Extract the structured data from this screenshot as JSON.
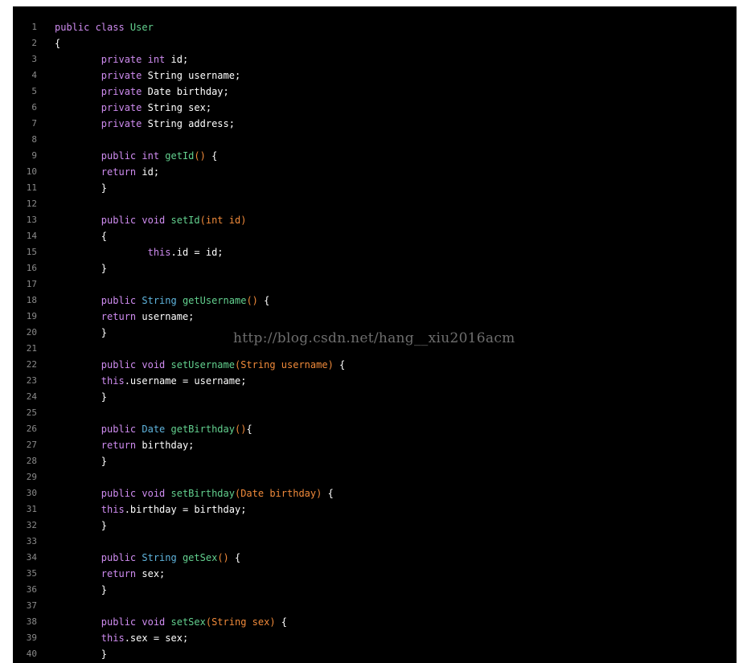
{
  "editor": {
    "lines": [
      {
        "n": "1",
        "tokens": [
          {
            "t": "public class ",
            "c": "kw"
          },
          {
            "t": "User",
            "c": "fn"
          }
        ]
      },
      {
        "n": "2",
        "tokens": [
          {
            "t": "{",
            "c": "pl"
          }
        ]
      },
      {
        "n": "3",
        "tokens": [
          {
            "t": "        ",
            "c": "pl"
          },
          {
            "t": "private int ",
            "c": "kw"
          },
          {
            "t": "id;",
            "c": "pl"
          }
        ]
      },
      {
        "n": "4",
        "tokens": [
          {
            "t": "        ",
            "c": "pl"
          },
          {
            "t": "private ",
            "c": "kw"
          },
          {
            "t": "String username;",
            "c": "pl"
          }
        ]
      },
      {
        "n": "5",
        "tokens": [
          {
            "t": "        ",
            "c": "pl"
          },
          {
            "t": "private ",
            "c": "kw"
          },
          {
            "t": "Date birthday;",
            "c": "pl"
          }
        ]
      },
      {
        "n": "6",
        "tokens": [
          {
            "t": "        ",
            "c": "pl"
          },
          {
            "t": "private ",
            "c": "kw"
          },
          {
            "t": "String sex;",
            "c": "pl"
          }
        ]
      },
      {
        "n": "7",
        "tokens": [
          {
            "t": "        ",
            "c": "pl"
          },
          {
            "t": "private ",
            "c": "kw"
          },
          {
            "t": "String address;",
            "c": "pl"
          }
        ]
      },
      {
        "n": "8",
        "tokens": []
      },
      {
        "n": "9",
        "tokens": [
          {
            "t": "        ",
            "c": "pl"
          },
          {
            "t": "public int ",
            "c": "kw"
          },
          {
            "t": "getId",
            "c": "fn"
          },
          {
            "t": "()",
            "c": "pn"
          },
          {
            "t": " {",
            "c": "pl"
          }
        ]
      },
      {
        "n": "10",
        "tokens": [
          {
            "t": "        ",
            "c": "pl"
          },
          {
            "t": "return ",
            "c": "kw"
          },
          {
            "t": "id;",
            "c": "pl"
          }
        ]
      },
      {
        "n": "11",
        "tokens": [
          {
            "t": "        }",
            "c": "pl"
          }
        ]
      },
      {
        "n": "12",
        "tokens": []
      },
      {
        "n": "13",
        "tokens": [
          {
            "t": "        ",
            "c": "pl"
          },
          {
            "t": "public void ",
            "c": "kw"
          },
          {
            "t": "setId",
            "c": "fn"
          },
          {
            "t": "(int id)",
            "c": "pn"
          }
        ]
      },
      {
        "n": "14",
        "tokens": [
          {
            "t": "        {",
            "c": "pl"
          }
        ]
      },
      {
        "n": "15",
        "tokens": [
          {
            "t": "                ",
            "c": "pl"
          },
          {
            "t": "this",
            "c": "kw"
          },
          {
            "t": ".id = id;",
            "c": "pl"
          }
        ]
      },
      {
        "n": "16",
        "tokens": [
          {
            "t": "        }",
            "c": "pl"
          }
        ]
      },
      {
        "n": "17",
        "tokens": []
      },
      {
        "n": "18",
        "tokens": [
          {
            "t": "        ",
            "c": "pl"
          },
          {
            "t": "public ",
            "c": "kw"
          },
          {
            "t": "String ",
            "c": "ty"
          },
          {
            "t": "getUsername",
            "c": "fn"
          },
          {
            "t": "()",
            "c": "pn"
          },
          {
            "t": " {",
            "c": "pl"
          }
        ]
      },
      {
        "n": "19",
        "tokens": [
          {
            "t": "        ",
            "c": "pl"
          },
          {
            "t": "return ",
            "c": "kw"
          },
          {
            "t": "username;",
            "c": "pl"
          }
        ]
      },
      {
        "n": "20",
        "tokens": [
          {
            "t": "        }",
            "c": "pl"
          }
        ]
      },
      {
        "n": "21",
        "tokens": []
      },
      {
        "n": "22",
        "tokens": [
          {
            "t": "        ",
            "c": "pl"
          },
          {
            "t": "public void ",
            "c": "kw"
          },
          {
            "t": "setUsername",
            "c": "fn"
          },
          {
            "t": "(String username)",
            "c": "pn"
          },
          {
            "t": " {",
            "c": "pl"
          }
        ]
      },
      {
        "n": "23",
        "tokens": [
          {
            "t": "        ",
            "c": "pl"
          },
          {
            "t": "this",
            "c": "kw"
          },
          {
            "t": ".username = username;",
            "c": "pl"
          }
        ]
      },
      {
        "n": "24",
        "tokens": [
          {
            "t": "        }",
            "c": "pl"
          }
        ]
      },
      {
        "n": "25",
        "tokens": []
      },
      {
        "n": "26",
        "tokens": [
          {
            "t": "        ",
            "c": "pl"
          },
          {
            "t": "public ",
            "c": "kw"
          },
          {
            "t": "Date ",
            "c": "ty"
          },
          {
            "t": "getBirthday",
            "c": "fn"
          },
          {
            "t": "()",
            "c": "pn"
          },
          {
            "t": "{",
            "c": "pl"
          }
        ]
      },
      {
        "n": "27",
        "tokens": [
          {
            "t": "        ",
            "c": "pl"
          },
          {
            "t": "return ",
            "c": "kw"
          },
          {
            "t": "birthday;",
            "c": "pl"
          }
        ]
      },
      {
        "n": "28",
        "tokens": [
          {
            "t": "        }",
            "c": "pl"
          }
        ]
      },
      {
        "n": "29",
        "tokens": []
      },
      {
        "n": "30",
        "tokens": [
          {
            "t": "        ",
            "c": "pl"
          },
          {
            "t": "public void ",
            "c": "kw"
          },
          {
            "t": "setBirthday",
            "c": "fn"
          },
          {
            "t": "(Date birthday)",
            "c": "pn"
          },
          {
            "t": " {",
            "c": "pl"
          }
        ]
      },
      {
        "n": "31",
        "tokens": [
          {
            "t": "        ",
            "c": "pl"
          },
          {
            "t": "this",
            "c": "kw"
          },
          {
            "t": ".birthday = birthday;",
            "c": "pl"
          }
        ]
      },
      {
        "n": "32",
        "tokens": [
          {
            "t": "        }",
            "c": "pl"
          }
        ]
      },
      {
        "n": "33",
        "tokens": []
      },
      {
        "n": "34",
        "tokens": [
          {
            "t": "        ",
            "c": "pl"
          },
          {
            "t": "public ",
            "c": "kw"
          },
          {
            "t": "String ",
            "c": "ty"
          },
          {
            "t": "getSex",
            "c": "fn"
          },
          {
            "t": "()",
            "c": "pn"
          },
          {
            "t": " {",
            "c": "pl"
          }
        ]
      },
      {
        "n": "35",
        "tokens": [
          {
            "t": "        ",
            "c": "pl"
          },
          {
            "t": "return ",
            "c": "kw"
          },
          {
            "t": "sex;",
            "c": "pl"
          }
        ]
      },
      {
        "n": "36",
        "tokens": [
          {
            "t": "        }",
            "c": "pl"
          }
        ]
      },
      {
        "n": "37",
        "tokens": []
      },
      {
        "n": "38",
        "tokens": [
          {
            "t": "        ",
            "c": "pl"
          },
          {
            "t": "public void ",
            "c": "kw"
          },
          {
            "t": "setSex",
            "c": "fn"
          },
          {
            "t": "(String sex)",
            "c": "pn"
          },
          {
            "t": " {",
            "c": "pl"
          }
        ]
      },
      {
        "n": "39",
        "tokens": [
          {
            "t": "        ",
            "c": "pl"
          },
          {
            "t": "this",
            "c": "kw"
          },
          {
            "t": ".sex = sex;",
            "c": "pl"
          }
        ]
      },
      {
        "n": "40",
        "tokens": [
          {
            "t": "        }",
            "c": "pl"
          }
        ]
      }
    ]
  },
  "watermark": "http://blog.csdn.net/hang__xiu2016acm",
  "colors": {
    "background": "#000000",
    "keyword": "#cf8cf0",
    "type": "#5fb4dd",
    "function_name": "#63d18f",
    "parameters": "#f08a3a",
    "plain": "#ffffff",
    "line_number": "#8a8a8a"
  }
}
